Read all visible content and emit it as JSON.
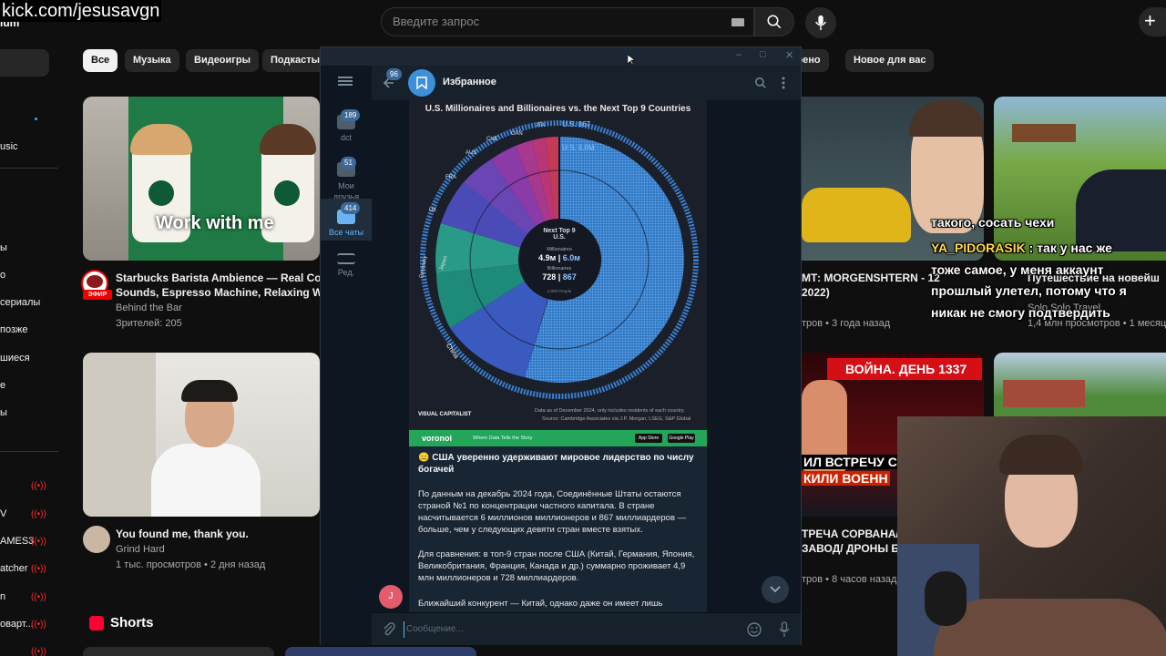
{
  "overlay": {
    "watermark": "kick.com/jesusavgn"
  },
  "youtube": {
    "logo_fragment": "ium",
    "search": {
      "placeholder": "Введите запрос"
    },
    "chips": [
      "Все",
      "Музыка",
      "Видеоигры",
      "Подкасты",
      "трено",
      "Новое для вас"
    ],
    "sidebar": {
      "items": [
        "usic",
        "ы",
        "о",
        "сериалы",
        "позже",
        "шиеся",
        "е",
        "ы"
      ],
      "live_items": [
        "V",
        "AMES3",
        "atcher",
        "n",
        "оварт..."
      ],
      "live_symbol": "((•))"
    },
    "videos": [
      {
        "title": "Starbucks Barista Ambience — Real Coffe",
        "title2": "Sounds, Espresso Machine, Relaxing Wor",
        "channel": "Behind the Bar",
        "meta": "Зрителей: 205",
        "overlay_text": "Work with me",
        "badge": "ЭФИР"
      },
      {
        "title": "You found me, thank you.",
        "channel": "Grind Hard",
        "meta": "1 тыс. просмотров • 2 дня назад"
      },
      {
        "title": "МТ: MORGENSHTERN - 12",
        "title2": "2022)",
        "meta": "тров • 3 года назад"
      },
      {
        "title": "Путешествие на новейш",
        "channel": "Solo Solo Travel",
        "meta": "1,4 млн просмотров • 1 месяц"
      },
      {
        "title": "ТРЕЧА СОРВАНА/",
        "title2": "ЗАВОД/ ДРОНЫ Б",
        "meta": "тров • 8 часов назад",
        "banner": "ВОЙНА. ДЕНЬ 1337",
        "banner2": "ИЛ ВСТРЕЧУ С",
        "banner3": "КИЛИ ВОЕНН"
      }
    ],
    "shorts_label": "Shorts"
  },
  "telegram": {
    "chat_title": "Избранное",
    "back_badge": "96",
    "folders": [
      {
        "label": "dct",
        "badge": "189"
      },
      {
        "label": "Мои друзья",
        "badge": "51"
      },
      {
        "label": "Все чаты",
        "badge": "414"
      },
      {
        "label": "Ред.",
        "badge": ""
      }
    ],
    "infographic": {
      "title": "U.S. Millionaires and Billionaires vs. the Next Top 9 Countries",
      "center_left_label": "Next Top 9",
      "center_right_label": "U.S.",
      "millionaires_label": "Millionaires",
      "mil_left": "4.9м",
      "mil_right": "6.0м",
      "billionaires_label": "Billionaires",
      "bil_left": "728",
      "bil_right": "867",
      "people_note": "1,000 People",
      "us_billionaires": "U.S. 867",
      "us_millionaires": "U.S. 6.0M",
      "country_labels": [
        "ITA",
        "CAN",
        "CHE",
        "AUS",
        "FRA",
        "UK",
        "Germany",
        "Japan",
        "China"
      ],
      "footnote": "Data as of December 2024, only includes residents of each country.",
      "source": "Source: Cambridge Associates via J.P. Morgan, LSEG, S&P Global",
      "brand": "VISUAL CAPITALIST"
    },
    "voronoi": {
      "name": "voronoi",
      "tagline": "Where Data Tells the Story",
      "store1": "App Store",
      "store2": "Google Play"
    },
    "message": {
      "headline": "😑 США уверенно удерживают мировое лидерство по числу богачей",
      "p1": "По данным на декабрь 2024 года, Соединённые Штаты остаются страной №1 по концентрации частного капитала. В стране насчитывается 6 миллионов миллионеров и 867 миллиардеров — больше, чем у следующих девяти стран вместе взятых.",
      "p2": "Для сравнения: в топ-9 стран после США (Китай, Германия, Япония, Великобритания, Франция, Канада и др.) суммарно проживает 4,9 млн миллионеров и 728 миллиардеров.",
      "p3": "Ближайший конкурент — Китай, однако даже он имеет лишь"
    },
    "sender_initial": "J",
    "input_placeholder": "Сообщение..."
  },
  "stream_chat": [
    {
      "user": "",
      "text": "такого, сосать чехи"
    },
    {
      "user": "YA_PIDORASIK",
      "text": ": так у нас же"
    },
    {
      "user": "",
      "text": "тоже самое, у меня аккаунт"
    },
    {
      "user": "",
      "text": "прошлый улетел, потому что я"
    },
    {
      "user": "",
      "text": "никак не смогу подтвердить"
    }
  ],
  "colors": {
    "tg_accent": "#6ab2f2",
    "tg_bg": "#17212b",
    "yt_bg": "#0f0f0f",
    "live_red": "#ff2a2a",
    "chat_user": "#ffd84a",
    "voronoi_green": "#23a55a"
  }
}
